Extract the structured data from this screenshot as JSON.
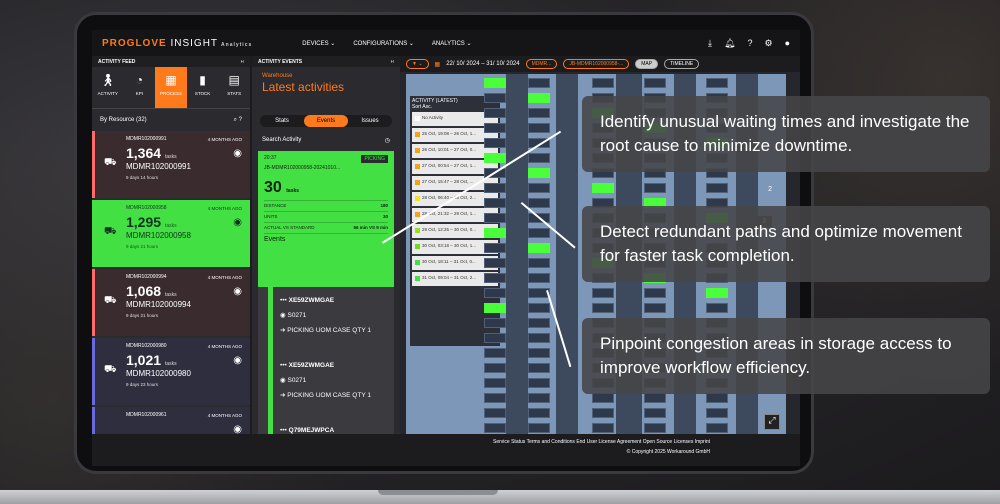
{
  "topbar": {
    "brand_a": "PROGLOVE",
    "brand_b": "INSIGHT",
    "brand_c": "Analytics",
    "menus": [
      "DEVICES",
      "CONFIGURATIONS",
      "ANALYTICS"
    ]
  },
  "feed": {
    "title": "ACTIVITY FEED",
    "tabs": [
      "ACTIVITY",
      "KPI",
      "PROCESS",
      "STOCK",
      "STATS"
    ],
    "by": "By Resource (32)"
  },
  "cards": [
    {
      "id": "MDMR102000991",
      "ago": "4 MONTHS AGO",
      "n": "1,364",
      "unit": "tasks",
      "name": "MDMR102000991",
      "d": "9 days 14 hours",
      "c": "#ff6b6b",
      "bg": "#3a2b2e"
    },
    {
      "id": "MDMR102000958",
      "ago": "4 MONTHS AGO",
      "n": "1,295",
      "unit": "tasks",
      "name": "MDMR102000958",
      "d": "9 days 21 hours",
      "c": "#43e043",
      "bg": "#43e043"
    },
    {
      "id": "MDMR102000994",
      "ago": "4 MONTHS AGO",
      "n": "1,068",
      "unit": "tasks",
      "name": "MDMR102000994",
      "d": "9 days 21 hours",
      "c": "#ff6b6b",
      "bg": "#3a2b2e"
    },
    {
      "id": "MDMR102000980",
      "ago": "4 MONTHS AGO",
      "n": "1,021",
      "unit": "tasks",
      "name": "MDMR102000980",
      "d": "9 days 23 hours",
      "c": "#6a6adf",
      "bg": "#2f2e3f"
    },
    {
      "id": "MDMR102000961",
      "ago": "4 MONTHS AGO",
      "n": "",
      "unit": "",
      "name": "",
      "d": "",
      "c": "#6a6adf",
      "bg": "#2f2e3f"
    }
  ],
  "events": {
    "title": "ACTIVITY EVENTS",
    "wh": "Warehouse",
    "latest": "Latest activities",
    "seg": [
      "Stats",
      "Events",
      "Issues"
    ],
    "search": "Search Activity",
    "card": {
      "time": "20:37",
      "badge": "PICKING",
      "ref": "JB-MDMR102000958-20241010...",
      "big": "30",
      "bigunit": "tasks",
      "dist": "DISTANCE",
      "distv": "180",
      "units": "UNITS",
      "unitsv": "30",
      "avs": "ACTUAL VS STANDARD",
      "avsv": "56 min VS 9 min",
      "events": "Events"
    },
    "items": [
      {
        "a": "XE59ZWMGAE",
        "b": "S0271",
        "c": "PICKING",
        "u": "UOM CASE",
        "q": "QTY 1",
        "t": "20:37"
      },
      {
        "a": "XE59ZWMGAE",
        "b": "S0271",
        "c": "PICKING",
        "u": "UOM CASE",
        "q": "QTY 1",
        "t": "20:37"
      },
      {
        "a": "Q79MEJWPCA"
      }
    ]
  },
  "map": {
    "dates": "22/ 10/ 2024 – 31/ 10/ 2024",
    "pill1": "MDMR...",
    "pill2": "JB-MDMR102000958-...",
    "btn1": "MAP",
    "btn2": "TIMELINE",
    "list_title": "ACTIVITY (LATEST)",
    "sort": "Sort Asc.",
    "no_act": "No Activity",
    "rows": [
      [
        "25 Oct, 19:08 – 26 Oct, 1...",
        "#f4a21a"
      ],
      [
        "26 Oct, 10:01 – 27 Oct, 0...",
        "#f4a21a"
      ],
      [
        "27 Oct, 00:54 – 27 Oct, 1...",
        "#f4a21a"
      ],
      [
        "27 Oct, 15:47 – 28 Oct, ...",
        "#f4a21a"
      ],
      [
        "28 Oct, 06:40 – 28 Oct, 2...",
        "#f4e11a"
      ],
      [
        "28 Oct, 21:32 – 29 Oct, 1...",
        "#f4a21a"
      ],
      [
        "29 Oct, 12:25 – 30 Oct, 0...",
        "#9ae01a"
      ],
      [
        "30 Oct, 03:18 – 30 Oct, 1...",
        "#6ae01a"
      ],
      [
        "30 Oct, 18:11 – 31 Oct, 0...",
        "#43e043"
      ],
      [
        "31 Oct, 09:04 – 31 Oct, 2...",
        "#43e043"
      ]
    ],
    "num": [
      "2",
      "3"
    ]
  },
  "footer": {
    "links": "Service Status   Terms and Conditions   End User License Agreement   Open Source Licenses   Imprint",
    "copy": "© Copyright 2025 Workaround GmbH"
  },
  "callouts": [
    "Identify unusual waiting times and investigate the root cause to minimize downtime.",
    "Detect redundant paths and optimize movement for faster task completion.",
    "Pinpoint congestion areas in storage access to improve workflow efficiency."
  ]
}
